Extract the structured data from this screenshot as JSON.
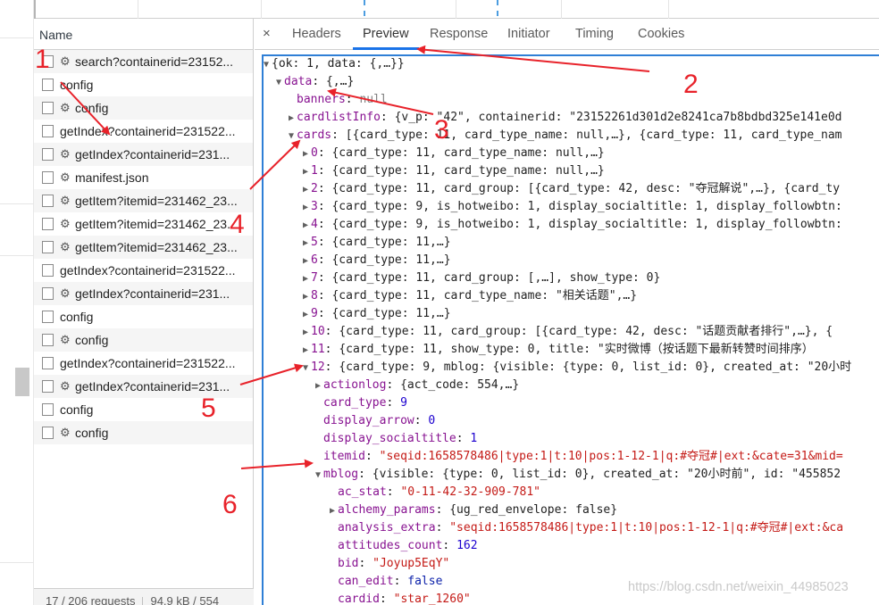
{
  "name_column": {
    "header": "Name",
    "requests": [
      {
        "name": "search?containerid=23152...",
        "icon": "gear-icon"
      },
      {
        "name": "config",
        "icon": ""
      },
      {
        "name": "config",
        "icon": "gear-icon"
      },
      {
        "name": "getIndex?containerid=231522...",
        "icon": ""
      },
      {
        "name": "getIndex?containerid=231...",
        "icon": "gear-icon"
      },
      {
        "name": "manifest.json",
        "icon": "gear-icon"
      },
      {
        "name": "getItem?itemid=231462_23...",
        "icon": "gear-icon"
      },
      {
        "name": "getItem?itemid=231462_23...",
        "icon": "gear-icon"
      },
      {
        "name": "getItem?itemid=231462_23...",
        "icon": "gear-icon"
      },
      {
        "name": "getIndex?containerid=231522...",
        "icon": ""
      },
      {
        "name": "getIndex?containerid=231...",
        "icon": "gear-icon"
      },
      {
        "name": "config",
        "icon": ""
      },
      {
        "name": "config",
        "icon": "gear-icon"
      },
      {
        "name": "getIndex?containerid=231522...",
        "icon": ""
      },
      {
        "name": "getIndex?containerid=231...",
        "icon": "gear-icon"
      },
      {
        "name": "config",
        "icon": ""
      },
      {
        "name": "config",
        "icon": "gear-icon"
      }
    ],
    "status": {
      "requests": "17 / 206 requests",
      "transferred": "94.9 kB / 554"
    }
  },
  "tabs": {
    "close": "×",
    "items": [
      "Headers",
      "Preview",
      "Response",
      "Initiator",
      "Timing",
      "Cookies"
    ],
    "active": "Preview"
  },
  "preview": {
    "lines": [
      {
        "tri": "▼",
        "key": "",
        "text": "{ok: 1, data: {,…}}"
      },
      {
        "tri": "▼",
        "key": "data",
        "text": "{,…}"
      },
      {
        "tri": "",
        "key": "banners",
        "text": "null"
      },
      {
        "tri": "▶",
        "key": "cardlistInfo",
        "text": "{v_p: \"42\", containerid: \"23152261d301d2e8241ca7b8bdbd325e141e0d"
      },
      {
        "tri": "▼",
        "key": "cards",
        "text": "[{card_type: 11, card_type_name: null,…}, {card_type: 11, card_type_nam"
      },
      {
        "tri": "▶",
        "key": "0",
        "text": "{card_type: 11, card_type_name: null,…}"
      },
      {
        "tri": "▶",
        "key": "1",
        "text": "{card_type: 11, card_type_name: null,…}"
      },
      {
        "tri": "▶",
        "key": "2",
        "text": "{card_type: 11, card_group: [{card_type: 42, desc: \"夺冠解说\",…}, {card_ty"
      },
      {
        "tri": "▶",
        "key": "3",
        "text": "{card_type: 9, is_hotweibo: 1, display_socialtitle: 1, display_followbtn:"
      },
      {
        "tri": "▶",
        "key": "4",
        "text": "{card_type: 9, is_hotweibo: 1, display_socialtitle: 1, display_followbtn:"
      },
      {
        "tri": "▶",
        "key": "5",
        "text": "{card_type: 11,…}"
      },
      {
        "tri": "▶",
        "key": "6",
        "text": "{card_type: 11,…}"
      },
      {
        "tri": "▶",
        "key": "7",
        "text": "{card_type: 11, card_group: [,…], show_type: 0}"
      },
      {
        "tri": "▶",
        "key": "8",
        "text": "{card_type: 11, card_type_name: \"相关话题\",…}"
      },
      {
        "tri": "▶",
        "key": "9",
        "text": "{card_type: 11,…}"
      },
      {
        "tri": "▶",
        "key": "10",
        "text": "{card_type: 11, card_group: [{card_type: 42, desc: \"话题贡献者排行\",…}, {"
      },
      {
        "tri": "▶",
        "key": "11",
        "text": "{card_type: 11, show_type: 0, title: \"实时微博（按话题下最新转赞时间排序）"
      },
      {
        "tri": "▼",
        "key": "12",
        "text": "{card_type: 9, mblog: {visible: {type: 0, list_id: 0}, created_at: \"20小时"
      },
      {
        "tri": "▶",
        "key": "actionlog",
        "text": "{act_code: 554,…}"
      },
      {
        "tri": "",
        "key": "card_type",
        "text": "9"
      },
      {
        "tri": "",
        "key": "display_arrow",
        "text": "0"
      },
      {
        "tri": "",
        "key": "display_socialtitle",
        "text": "1"
      },
      {
        "tri": "",
        "key": "itemid",
        "text": "\"seqid:1658578486|type:1|t:10|pos:1-12-1|q:#夺冠#|ext:&cate=31&mid="
      },
      {
        "tri": "▼",
        "key": "mblog",
        "text": "{visible: {type: 0, list_id: 0}, created_at: \"20小时前\", id: \"455852"
      },
      {
        "tri": "",
        "key": "ac_stat",
        "text": "\"0-11-42-32-909-781\""
      },
      {
        "tri": "▶",
        "key": "alchemy_params",
        "text": "{ug_red_envelope: false}"
      },
      {
        "tri": "",
        "key": "analysis_extra",
        "text": "\"seqid:1658578486|type:1|t:10|pos:1-12-1|q:#夺冠#|ext:&ca"
      },
      {
        "tri": "",
        "key": "attitudes_count",
        "text": "162"
      },
      {
        "tri": "",
        "key": "bid",
        "text": "\"Joyup5EqY\""
      },
      {
        "tri": "",
        "key": "can_edit",
        "text": "false"
      },
      {
        "tri": "",
        "key": "cardid",
        "text": "\"star_1260\""
      }
    ]
  },
  "annotations": [
    "1",
    "2",
    "3",
    "4",
    "5",
    "6"
  ],
  "annotation_color": "#e8222a",
  "watermark": "https://blog.csdn.net/weixin_44985023"
}
